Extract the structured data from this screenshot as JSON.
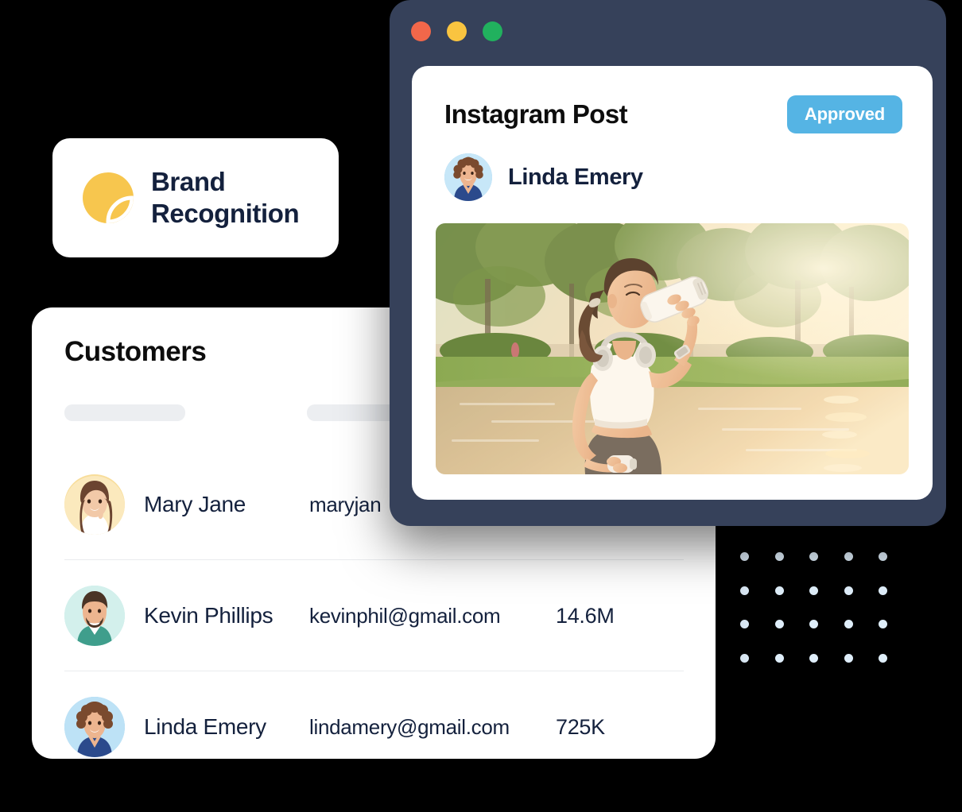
{
  "theme": {
    "page_background": "#000000",
    "card_background": "#ffffff",
    "window_background": "#36415a",
    "text_dark": "#14213d",
    "accent_blue": "#55b4e4",
    "accent_yellow": "#f7c64e",
    "skeleton_gray": "#eceef1",
    "dot_grid_color": "#dfeefa"
  },
  "brand_card": {
    "icon_name": "brand-recognition-icon",
    "icon_color": "#f7c64e",
    "label_line_1": "Brand",
    "label_line_2": "Recognition"
  },
  "customers_card": {
    "title": "Customers",
    "column_headers": [
      {
        "name": "name-column-placeholder",
        "value": ""
      },
      {
        "name": "email-column-placeholder",
        "value": ""
      }
    ],
    "rows": [
      {
        "avatar_name": "avatar-mary-jane",
        "avatar_bg": "#f6d98e",
        "name": "Mary Jane",
        "email": "maryjan",
        "followers": ""
      },
      {
        "avatar_name": "avatar-kevin-phillips",
        "avatar_bg": "#b5e4e0",
        "name": "Kevin Phillips",
        "email": "kevinphil@gmail.com",
        "followers": "14.6M"
      },
      {
        "avatar_name": "avatar-linda-emery",
        "avatar_bg": "#a9d9f2",
        "name": "Linda Emery",
        "email": "lindamery@gmail.com",
        "followers": "725K"
      }
    ]
  },
  "browser_window": {
    "traffic_lights": [
      {
        "name": "window-close-dot",
        "color": "#f2674a"
      },
      {
        "name": "window-minimize-dot",
        "color": "#f9c440"
      },
      {
        "name": "window-maximize-dot",
        "color": "#21b15e"
      }
    ],
    "post": {
      "title": "Instagram Post",
      "status_badge": "Approved",
      "author": {
        "name": "Linda Emery",
        "avatar_name": "avatar-post-author",
        "avatar_bg": "#a9d9f2"
      },
      "media": {
        "name": "post-photo",
        "description": "Woman drinking from a bottle in a park at sunset beside a lake"
      }
    }
  },
  "dot_grid": {
    "name": "dot-grid-decoration",
    "columns": 5,
    "rows": 4
  }
}
